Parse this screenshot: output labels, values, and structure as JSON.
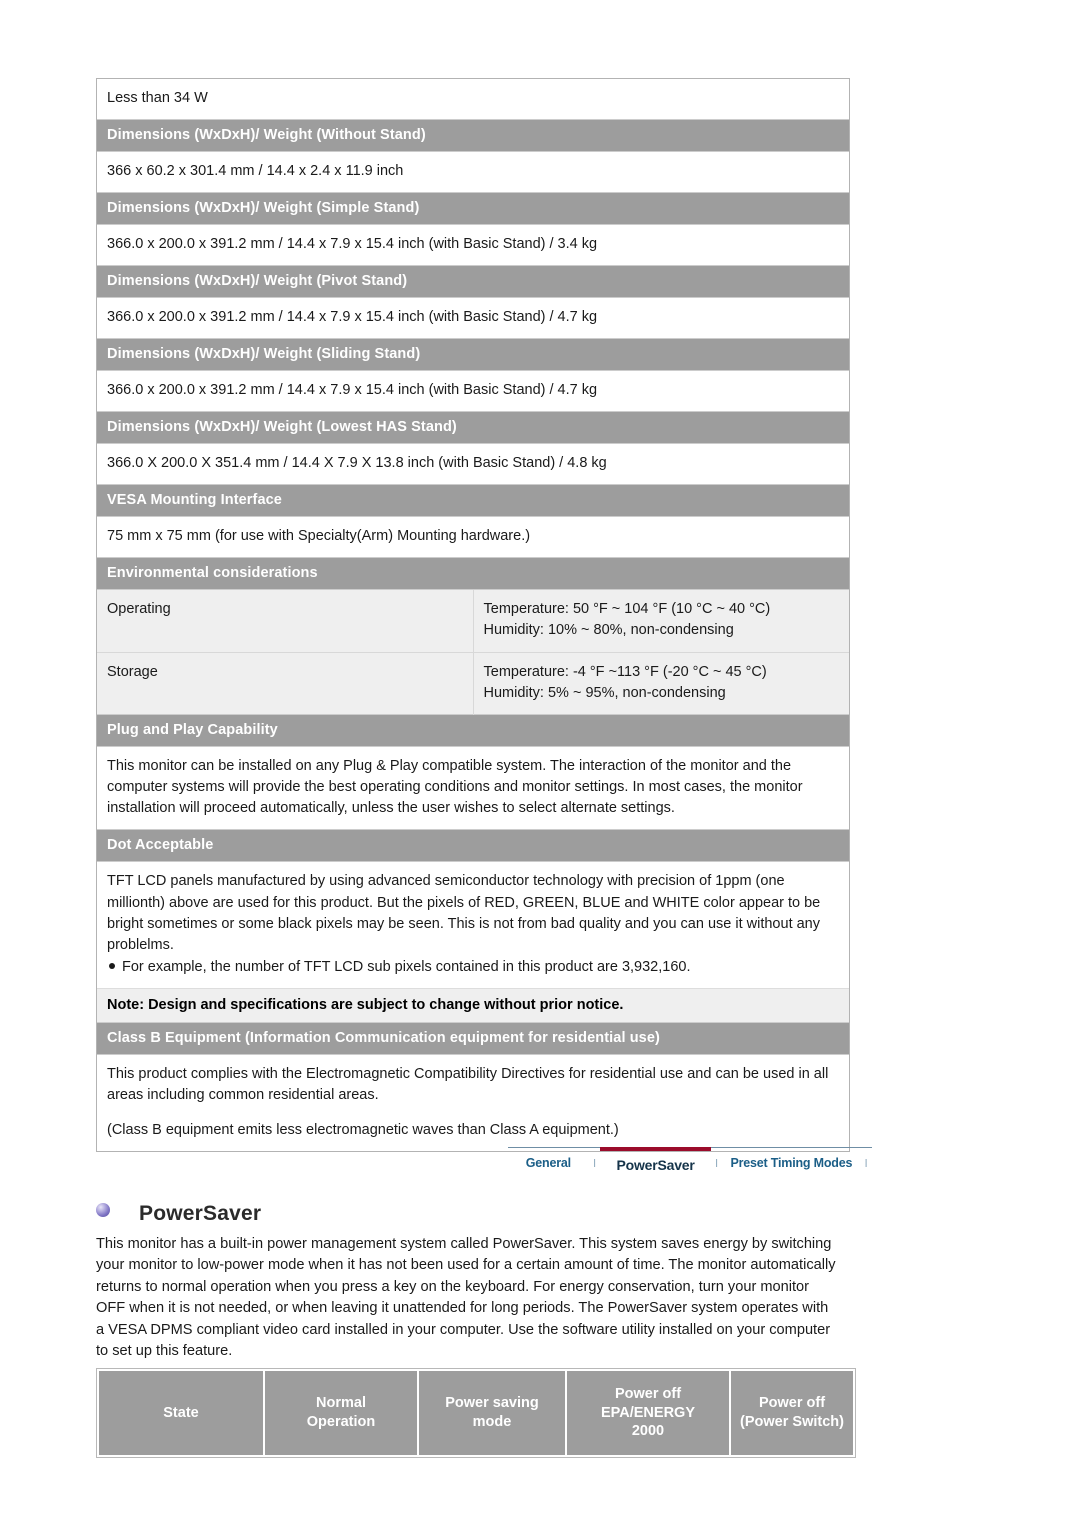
{
  "spec_rows": [
    {
      "type": "value",
      "text": "Less than 34 W"
    },
    {
      "type": "header",
      "text": "Dimensions (WxDxH)/ Weight (Without Stand)"
    },
    {
      "type": "value",
      "text": "366 x 60.2 x 301.4 mm / 14.4 x 2.4 x 11.9 inch"
    },
    {
      "type": "header",
      "text": "Dimensions (WxDxH)/ Weight (Simple Stand)"
    },
    {
      "type": "value",
      "text": "366.0 x 200.0 x 391.2 mm / 14.4 x 7.9 x 15.4 inch (with Basic Stand) / 3.4 kg"
    },
    {
      "type": "header",
      "text": "Dimensions (WxDxH)/ Weight (Pivot Stand)"
    },
    {
      "type": "value",
      "text": "366.0 x 200.0 x 391.2 mm / 14.4 x 7.9 x 15.4 inch (with Basic Stand) / 4.7 kg"
    },
    {
      "type": "header",
      "text": "Dimensions (WxDxH)/ Weight (Sliding Stand)"
    },
    {
      "type": "value",
      "text": "366.0 x 200.0 x 391.2 mm / 14.4 x 7.9 x 15.4 inch (with Basic Stand) / 4.7 kg"
    },
    {
      "type": "header",
      "text": "Dimensions (WxDxH)/ Weight (Lowest HAS Stand)"
    },
    {
      "type": "value",
      "text": "366.0 X 200.0 X 351.4 mm / 14.4 X 7.9 X 13.8 inch (with Basic Stand) / 4.8 kg"
    },
    {
      "type": "header",
      "text": "VESA Mounting Interface"
    },
    {
      "type": "value",
      "text": "75 mm x 75 mm (for use with Specialty(Arm) Mounting hardware.)"
    },
    {
      "type": "header",
      "text": "Environmental considerations"
    }
  ],
  "environmental": {
    "operating": {
      "label": "Operating",
      "temperature": "Temperature: 50 °F ~ 104 °F (10 °C ~ 40 °C)",
      "humidity": "Humidity: 10% ~ 80%, non-condensing"
    },
    "storage": {
      "label": "Storage",
      "temperature": "Temperature: -4 °F ~113 °F (-20 °C ~ 45 °C)",
      "humidity": "Humidity: 5% ~ 95%, non-condensing"
    }
  },
  "plug_and_play": {
    "header": "Plug and Play Capability",
    "body": "This monitor can be installed on any Plug & Play compatible system. The interaction of the monitor and the computer systems will provide the best operating conditions and monitor settings. In most cases, the monitor installation will proceed automatically, unless the user wishes to select alternate settings."
  },
  "dot_acceptable": {
    "header": "Dot Acceptable",
    "body": "TFT LCD panels manufactured by using advanced semiconductor technology with precision of 1ppm (one millionth) above are used for this product. But the pixels of RED, GREEN, BLUE and WHITE color appear to be bright sometimes or some black pixels may be seen. This is not from bad quality and you can use it without any problelms.",
    "bullet": "For example, the number of TFT LCD sub pixels contained in this product are 3,932,160."
  },
  "note": "Note: Design and specifications are subject to change without prior notice.",
  "class_b": {
    "header": "Class B Equipment (Information Communication equipment for residential use)",
    "body_1": "This product complies with the Electromagnetic Compatibility Directives for residential use and can be used in all areas including common residential areas.",
    "body_2": "(Class B equipment emits less electromagnetic waves than Class A equipment.)"
  },
  "tabs": {
    "general": "General",
    "powersaver": "PowerSaver",
    "preset": "Preset Timing Modes",
    "separator": "l",
    "active_color": "#9b0c2b",
    "link_color": "#1b5e87"
  },
  "powersaver": {
    "title": "PowerSaver",
    "bullet_icon": "sphere-bullet-icon",
    "paragraph": "This monitor has a built-in power management system called PowerSaver. This system saves energy by switching your monitor to low-power mode when it has not been used for a certain amount of time. The monitor automatically returns to normal operation when you press a key on the keyboard. For energy conservation, turn your monitor OFF when it is not needed, or when leaving it unattended for long periods. The PowerSaver system operates with a VESA DPMS compliant video card installed in your computer. Use the software utility installed on your computer to set up this feature.",
    "table": {
      "headers": [
        {
          "lines": [
            "State"
          ]
        },
        {
          "lines": [
            "Normal",
            "Operation"
          ]
        },
        {
          "lines": [
            "Power saving",
            "mode"
          ]
        },
        {
          "lines": [
            "Power off",
            "EPA/ENERGY",
            "2000"
          ]
        },
        {
          "lines": [
            "Power off",
            "(Power Switch)"
          ]
        }
      ]
    }
  },
  "colors": {
    "header_gray": "#9d9d9d",
    "stripe_gray": "#efefef",
    "border_gray": "#b3b3b3",
    "text": "#1a1a1a"
  }
}
